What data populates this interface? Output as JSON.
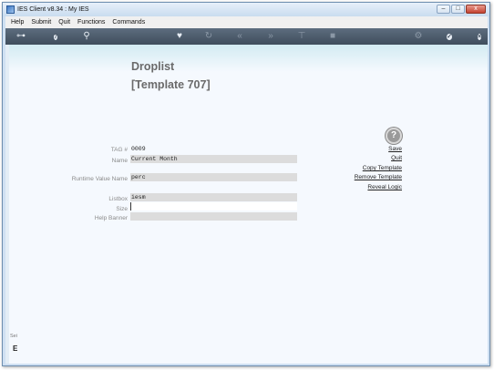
{
  "window": {
    "title": "IES Client v8.34 : My IES",
    "controls": [
      "–",
      "□",
      "x"
    ]
  },
  "menu": [
    "Help",
    "Submit",
    "Quit",
    "Functions",
    "Commands"
  ],
  "toolbar": {
    "icons": [
      {
        "name": "key-icon",
        "glyph": "⊶"
      },
      {
        "name": "help-circle-icon",
        "glyph": "?"
      },
      {
        "name": "search-icon",
        "glyph": "⚲"
      },
      {
        "name": "heart-icon",
        "glyph": "♥"
      },
      {
        "name": "refresh-icon",
        "glyph": "↻"
      },
      {
        "name": "rewind-icon",
        "glyph": "«"
      },
      {
        "name": "fast-forward-icon",
        "glyph": "»"
      },
      {
        "name": "pin-icon",
        "glyph": "⊤"
      },
      {
        "name": "stop-icon",
        "glyph": "■"
      },
      {
        "name": "settings-icon",
        "glyph": "⚙"
      },
      {
        "name": "check-icon",
        "glyph": "✓"
      },
      {
        "name": "close-circle-icon",
        "glyph": "×"
      }
    ]
  },
  "page": {
    "title": "Droplist",
    "subtitle": "[Template 707]"
  },
  "form": {
    "tag_label": "TAG #",
    "tag_value": "0009",
    "name_label": "Name",
    "name_value": "Current Month",
    "runtime_label": "Runtime Value Name",
    "runtime_value": "perc",
    "listbox_label": "Listbox",
    "listbox_value": "iesm",
    "size_label": "Size",
    "size_value": "",
    "banner_label": "Help Banner",
    "banner_value": ""
  },
  "actions": {
    "help_glyph": "?",
    "save": "Save",
    "quit": "Quit",
    "copy": "Copy Template",
    "remove": "Remove Template",
    "reveal": "Reveal Logic"
  },
  "sidebar": {
    "stub_text": "Sei",
    "stub_letter": "E"
  }
}
